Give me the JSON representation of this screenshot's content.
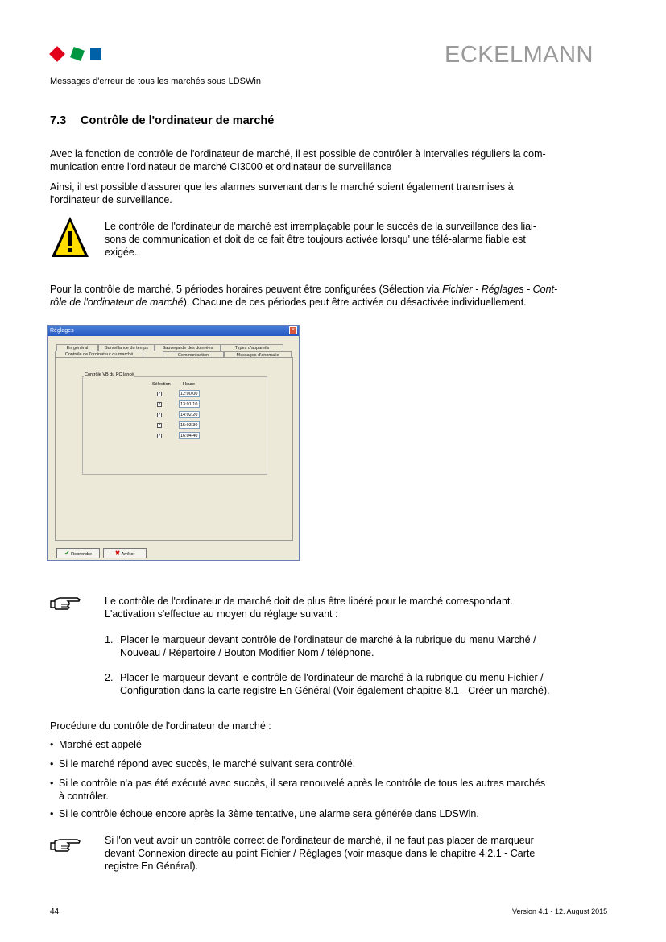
{
  "header": {
    "brand": "ECKELMANN",
    "subtitle": "Messages d'erreur de tous les marchés sous LDSWin",
    "logo_colors": [
      "#e2001a",
      "#009640",
      "#0060a8"
    ]
  },
  "section": {
    "number": "7.3",
    "title": "Contrôle de l'ordinateur de marché"
  },
  "intro": {
    "p1_line1": "Avec la fonction de contrôle de l'ordinateur de marché, il est possible de contrôler à intervalles réguliers la com-",
    "p1_line2": "munication entre l'ordinateur de marché CI3000 et ordinateur de surveillance",
    "p2_line1": "Ainsi, il est possible d'assurer que les alarmes survenant dans le marché soient également transmises à",
    "p2_line2": "l'ordinateur de surveillance."
  },
  "warning": {
    "line1": "Le contrôle de l'ordinateur de marché est irremplaçable pour le succès de la surveillance des liai-",
    "line2": "sons de communication et doit de ce fait être toujours activée lorsqu' une télé-alarme fiable est",
    "line3": "exigée."
  },
  "periods": {
    "line1_a": "Pour la contrôle de marché, 5 périodes horaires peuvent être configurées (Sélection via ",
    "line1_italic": "Fichier - Réglages - Cont-",
    "line2_italic": "rôle de l'ordinateur de marché",
    "line2_b": "). Chacune de ces périodes peut être activée ou désactivée individuellement."
  },
  "dialog": {
    "title": "Réglages",
    "tabs_row1": [
      "En général",
      "Surveillance du temps",
      "Sauvegarde des données",
      "Types d'appareils"
    ],
    "tabs_row2": [
      "Contrôle de l'ordinateur du marché",
      "Communication",
      "Messages d'anomalie"
    ],
    "group_label": "Contrôle VB du PC lancé",
    "col_selection": "Sélection",
    "col_hour": "Heure",
    "rows": [
      {
        "checked": true,
        "time": "12:00:00"
      },
      {
        "checked": true,
        "time": "13:01:10"
      },
      {
        "checked": true,
        "time": "14:02:20"
      },
      {
        "checked": true,
        "time": "15:03:30"
      },
      {
        "checked": true,
        "time": "16:04:40"
      }
    ],
    "ok_label": "Reprendre",
    "cancel_label": "Arrêter"
  },
  "note1": {
    "line1": "Le contrôle de l'ordinateur de marché doit de plus être libéré pour le marché correspondant.",
    "line2": "L'activation s'effectue au moyen du réglage suivant :",
    "item1_num": "1.",
    "item1_line1": "Placer le marqueur devant  contrôle de l'ordinateur de marché à la rubrique du menu Marché /",
    "item1_line2": "Nouveau / Répertoire / Bouton  Modifier Nom / téléphone.",
    "item2_num": "2.",
    "item2_line1": "Placer le marqueur devant le contrôle de l'ordinateur de marché à la rubrique du menu Fichier /",
    "item2_line2": "Configuration dans la carte registre En Général (Voir également chapitre 8.1 - Créer un marché)."
  },
  "procedure": {
    "heading": "Procédure du contrôle de l'ordinateur de marché :",
    "b1": "Marché est appelé",
    "b2": "Si le marché répond avec succès, le marché suivant sera contrôlé.",
    "b3_line1": "Si le contrôle n'a pas été exécuté avec succès, il sera renouvelé après le contrôle de tous les autres marchés",
    "b3_line2": "à contrôler.",
    "b4": "Si le contrôle échoue encore après la 3ème tentative, une alarme sera générée dans LDSWin."
  },
  "note2": {
    "line1": "Si l'on veut avoir un contrôle correct de l'ordinateur de marché, il ne faut pas placer de marqueur",
    "line2": "devant  Connexion directe  au point  Fichier / Réglages  (voir masque dans le chapitre 4.2.1 - Carte",
    "line3": "registre En Général)."
  },
  "footer": {
    "page": "44",
    "version": "Version 4.1 -  12. August 2015"
  }
}
